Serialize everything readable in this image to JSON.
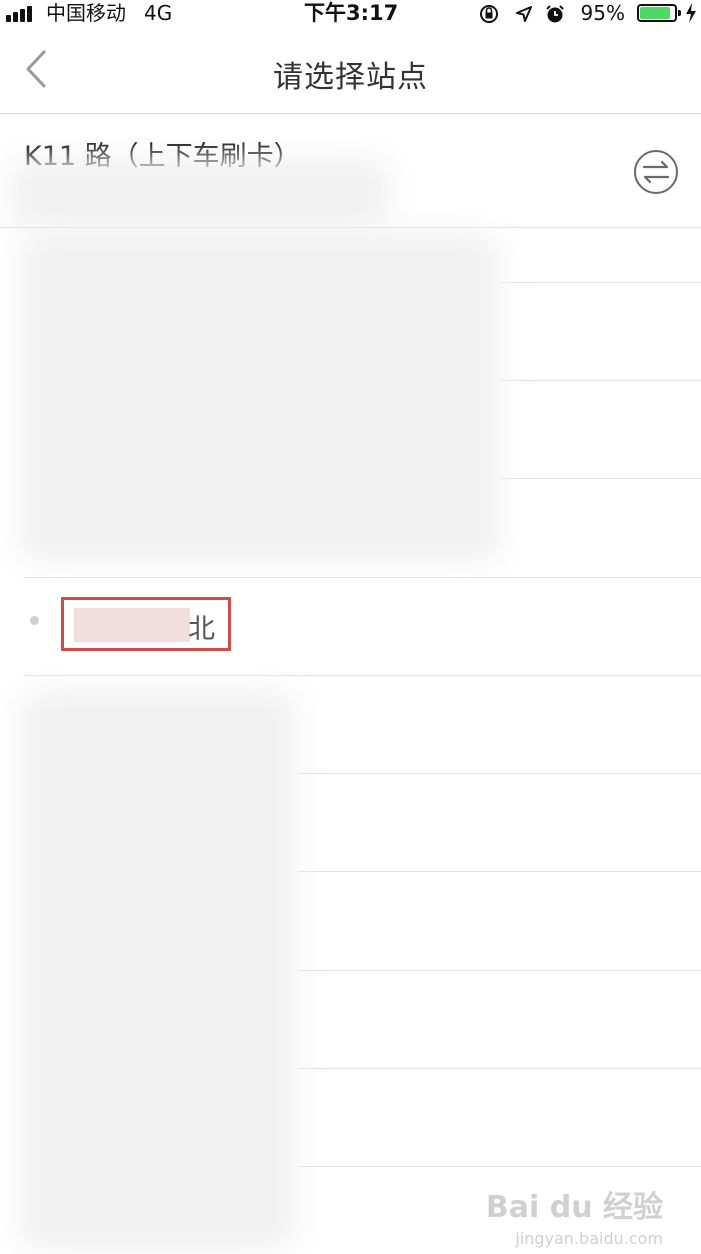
{
  "status_bar": {
    "carrier": "中国移动",
    "network": "4G",
    "time": "下午3:17",
    "battery_percent": "95%",
    "battery_level": 0.95,
    "battery_color": "#4cd964",
    "icons": [
      "signal-icon",
      "orientation-lock-icon",
      "location-icon",
      "alarm-icon",
      "battery-icon",
      "charging-icon"
    ]
  },
  "nav": {
    "title": "请选择站点",
    "back_icon": "chevron-left-icon"
  },
  "route": {
    "name": "K11 路（上下车刷卡）",
    "swap_icon": "swap-direction-icon"
  },
  "stations": {
    "highlighted": {
      "suffix": "北",
      "highlight_color": "#d44a4a"
    }
  },
  "watermark": {
    "logo": "Bai du 经验",
    "url": "jingyan.baidu.com"
  }
}
